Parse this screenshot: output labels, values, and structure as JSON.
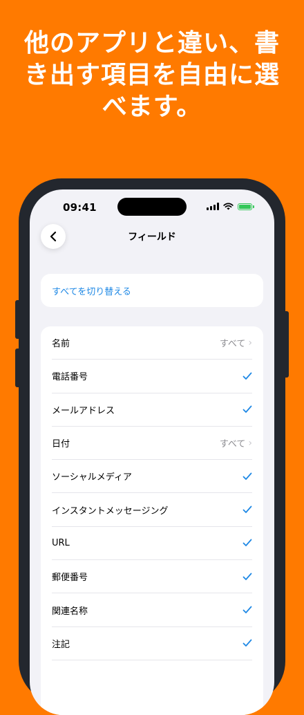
{
  "headline": {
    "line1": "他のアプリと違い、書",
    "line2": "き出す項目を自由に選",
    "line3": "べます。"
  },
  "status_bar": {
    "time": "09:41"
  },
  "nav": {
    "title": "フィールド"
  },
  "toggle_all": {
    "label": "すべてを切り替える"
  },
  "fields": [
    {
      "label": "名前",
      "value": "すべて",
      "type": "disclosure"
    },
    {
      "label": "電話番号",
      "type": "checked"
    },
    {
      "label": "メールアドレス",
      "type": "checked"
    },
    {
      "label": "日付",
      "value": "すべて",
      "type": "disclosure"
    },
    {
      "label": "ソーシャルメディア",
      "type": "checked"
    },
    {
      "label": "インスタントメッセージング",
      "type": "checked"
    },
    {
      "label": "URL",
      "type": "checked"
    },
    {
      "label": "郵便番号",
      "type": "checked"
    },
    {
      "label": "関連名称",
      "type": "checked"
    },
    {
      "label": "注記",
      "type": "checked"
    }
  ],
  "colors": {
    "background": "#FF7A00",
    "accent": "#1E88E5",
    "battery": "#34C759"
  }
}
